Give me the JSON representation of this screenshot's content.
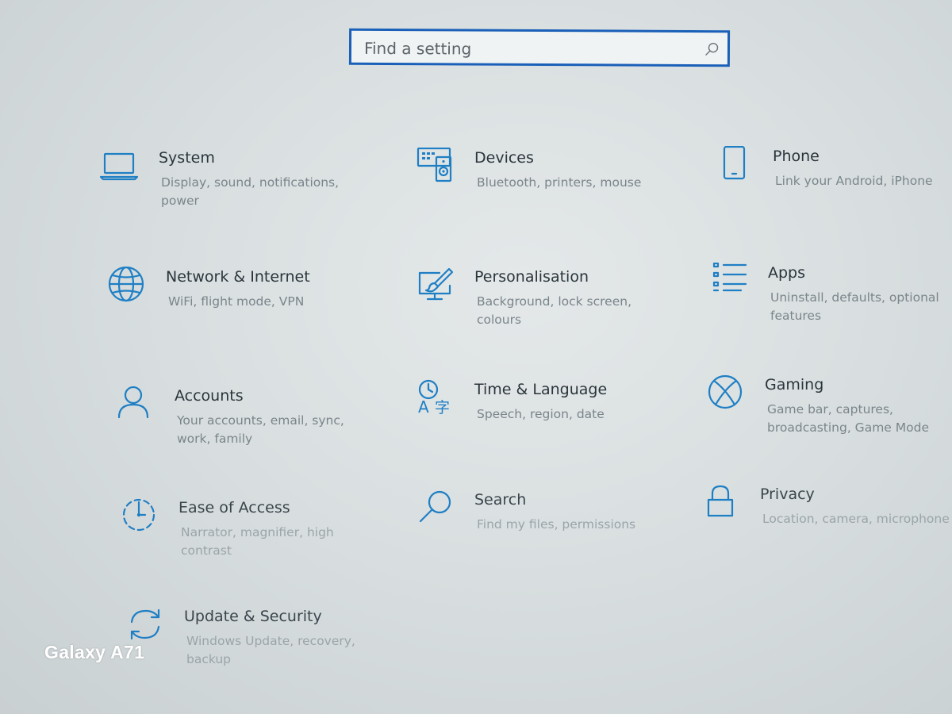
{
  "search": {
    "placeholder": "Find a setting"
  },
  "tiles": [
    {
      "title": "System",
      "desc": "Display, sound, notifications, power",
      "icon": "laptop-icon"
    },
    {
      "title": "Devices",
      "desc": "Bluetooth, printers, mouse",
      "icon": "keyboard-speaker-icon"
    },
    {
      "title": "Phone",
      "desc": "Link your Android, iPhone",
      "icon": "phone-icon"
    },
    {
      "title": "Network & Internet",
      "desc": "WiFi, flight mode, VPN",
      "icon": "globe-icon"
    },
    {
      "title": "Personalisation",
      "desc": "Background, lock screen, colours",
      "icon": "paintbrush-icon"
    },
    {
      "title": "Apps",
      "desc": "Uninstall, defaults, optional features",
      "icon": "list-icon"
    },
    {
      "title": "Accounts",
      "desc": "Your accounts, email, sync, work, family",
      "icon": "person-icon"
    },
    {
      "title": "Time & Language",
      "desc": "Speech, region, date",
      "icon": "time-language-icon"
    },
    {
      "title": "Gaming",
      "desc": "Game bar, captures, broadcasting, Game Mode",
      "icon": "xbox-icon"
    },
    {
      "title": "Ease of Access",
      "desc": "Narrator, magnifier, high contrast",
      "icon": "ease-of-access-icon"
    },
    {
      "title": "Search",
      "desc": "Find my files, permissions",
      "icon": "search-icon"
    },
    {
      "title": "Privacy",
      "desc": "Location, camera, microphone",
      "icon": "lock-icon"
    },
    {
      "title": "Update & Security",
      "desc": "Windows Update, recovery, backup",
      "icon": "sync-arrows-icon"
    }
  ],
  "watermark": "Galaxy A71",
  "colors": {
    "accent": "#1f7fc4",
    "search_border": "#1a5fb8"
  }
}
